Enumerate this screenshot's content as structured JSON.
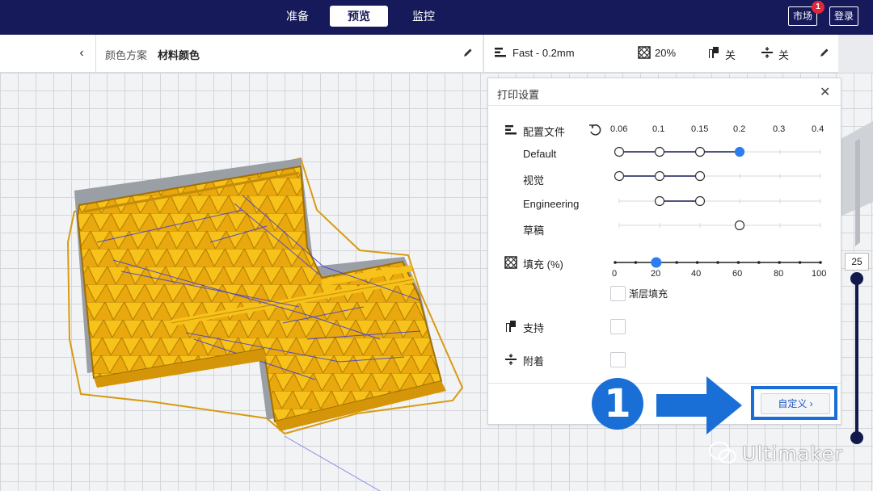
{
  "topbar": {
    "tabs": [
      {
        "label": "准备",
        "active": false
      },
      {
        "label": "预览",
        "active": true
      },
      {
        "label": "监控",
        "active": false
      }
    ],
    "marketplace_label": "市场",
    "marketplace_badge": "1",
    "login_label": "登录"
  },
  "color_scheme": {
    "label": "颜色方案",
    "value": "材料颜色"
  },
  "print_header": {
    "profile": "Fast - 0.2mm",
    "infill": "20%",
    "support": "关",
    "adhesion": "关"
  },
  "print_settings": {
    "title": "打印设置",
    "profile_label": "配置文件",
    "layer_heights": [
      "0.06",
      "0.1",
      "0.15",
      "0.2",
      "0.3",
      "0.4"
    ],
    "profiles": [
      {
        "name": "Default",
        "available": [
          "0.06",
          "0.1",
          "0.15",
          "0.2"
        ],
        "selected": "0.2"
      },
      {
        "name": "视觉",
        "available": [
          "0.06",
          "0.1",
          "0.15"
        ]
      },
      {
        "name": "Engineering",
        "available": [
          "0.1",
          "0.15"
        ]
      },
      {
        "name": "草稿",
        "available": [
          "0.2"
        ]
      }
    ],
    "infill_label": "填充 (%)",
    "infill_ticks": [
      "0",
      "20",
      "40",
      "60",
      "80",
      "100"
    ],
    "infill_value": 20,
    "gradual_infill_label": "渐层填充",
    "support_label": "支持",
    "adhesion_label": "附着",
    "custom_button": "自定义"
  },
  "annotation": {
    "step_number": "1"
  },
  "layer_view": {
    "current_layer": "25"
  },
  "watermark": {
    "text": "Ultimaker"
  },
  "colors": {
    "topbar": "#16195a",
    "accent": "#1a6fd6",
    "model_yellow": "#f5c518",
    "travel_blue": "#3a3adf"
  }
}
